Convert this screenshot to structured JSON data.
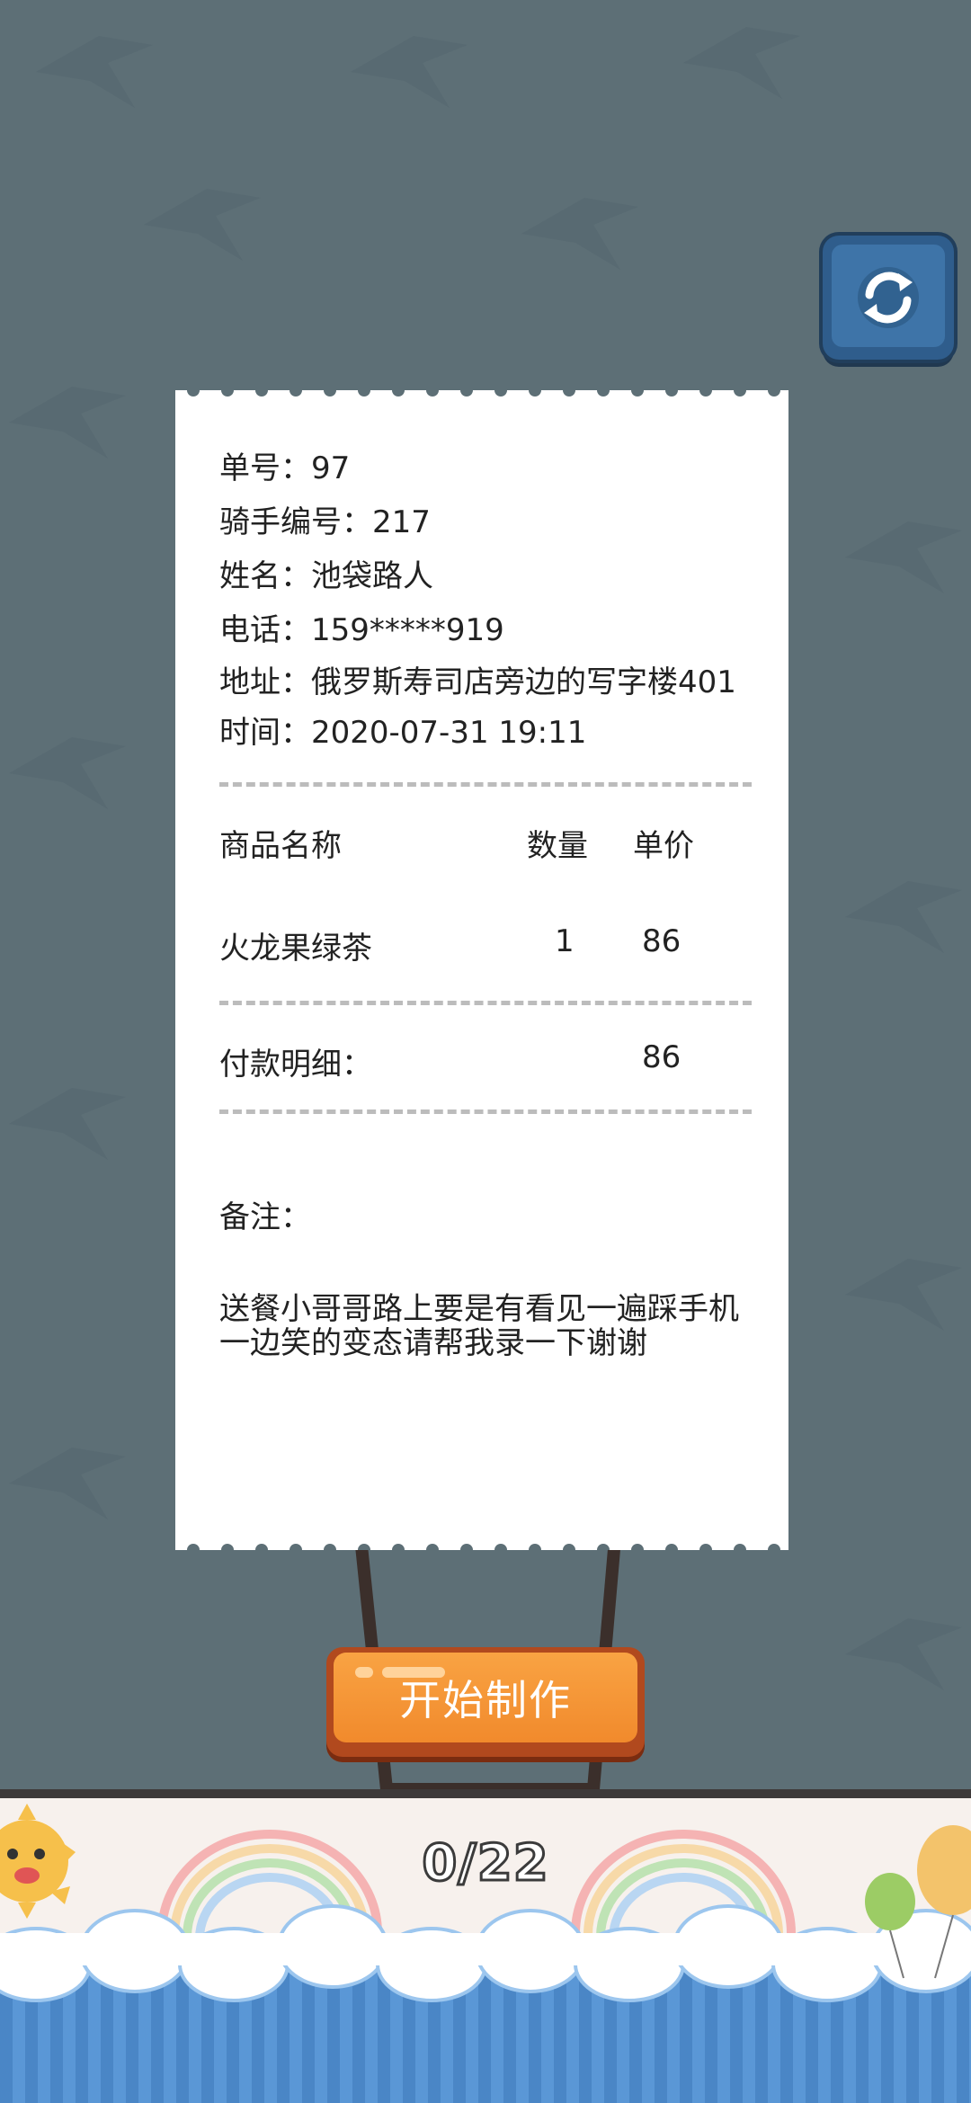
{
  "receipt": {
    "order_no": "单号：97",
    "rider_no": "骑手编号：217",
    "name": "姓名：池袋路人",
    "phone": "电话：159*****919",
    "address": "地址：俄罗斯寿司店旁边的写字楼401",
    "time": "时间：2020-07-31 19:11",
    "items_header": {
      "name": "商品名称",
      "qty": "数量",
      "price": "单价"
    },
    "items": [
      {
        "name": "火龙果绿茶",
        "qty": "1",
        "price": "86"
      }
    ],
    "payment_label": "付款明细：",
    "payment_total": "86",
    "note_label": "备注：",
    "note_text": "送餐小哥哥路上要是有看见一遍踩手机一边笑的变态请帮我录一下谢谢"
  },
  "buttons": {
    "start": "开始制作",
    "refresh_icon": "refresh-icon"
  },
  "progress": {
    "text": "0/22",
    "current": 0,
    "total": 22
  },
  "colors": {
    "background": "#5d6f76",
    "start_button": "#f18a2c",
    "refresh_button": "#3e74a8",
    "water": "#4f8fd2"
  }
}
